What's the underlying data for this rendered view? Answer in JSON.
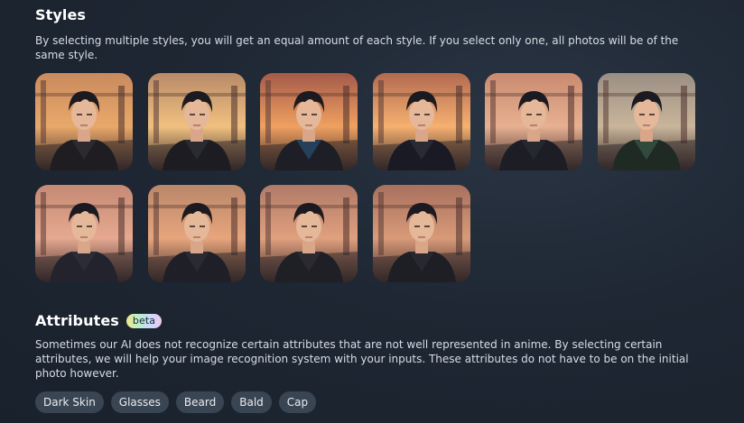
{
  "styles": {
    "title": "Styles",
    "description": "By selecting multiple styles, you will get an equal amount of each style. If you select only one, all photos will be of the same style.",
    "items": [
      {
        "name": "style-1",
        "sky": "#c98a5e",
        "glow": "#e9a86a",
        "shirt": "#2b2a2e",
        "jacket": "#1f1d22"
      },
      {
        "name": "style-2",
        "sky": "#b88a68",
        "glow": "#f0c080",
        "shirt": "#2a2b30",
        "jacket": "#1c1c22"
      },
      {
        "name": "style-3",
        "sky": "#a45a4a",
        "glow": "#f0a060",
        "shirt": "#24405a",
        "jacket": "#1d1e26"
      },
      {
        "name": "style-4",
        "sky": "#b26a50",
        "glow": "#f6b070",
        "shirt": "#2a2a35",
        "jacket": "#1a1a24"
      },
      {
        "name": "style-5",
        "sky": "#c98a70",
        "glow": "#e7b090",
        "shirt": "#262830",
        "jacket": "#1d1d25"
      },
      {
        "name": "style-6",
        "sky": "#9a8e84",
        "glow": "#c9b59a",
        "shirt": "#324a3c",
        "jacket": "#1f2a25"
      },
      {
        "name": "style-7",
        "sky": "#c58a74",
        "glow": "#e6a890",
        "shirt": "#2b2c36",
        "jacket": "#22232d"
      },
      {
        "name": "style-8",
        "sky": "#b9876a",
        "glow": "#e7a57c",
        "shirt": "#2a2a33",
        "jacket": "#1f1f28"
      },
      {
        "name": "style-9",
        "sky": "#b07a68",
        "glow": "#e0a07e",
        "shirt": "#2a2a30",
        "jacket": "#1f1f26"
      },
      {
        "name": "style-10",
        "sky": "#a8705e",
        "glow": "#d89a78",
        "shirt": "#28282f",
        "jacket": "#1e1e25"
      }
    ]
  },
  "attributes": {
    "title": "Attributes",
    "badge": "beta",
    "description": "Sometimes our AI does not recognize certain attributes that are not well represented in anime. By selecting certain attributes, we will help your image recognition system with your inputs. These attributes do not have to be on the initial photo however.",
    "chips": [
      "Dark Skin",
      "Glasses",
      "Beard",
      "Bald",
      "Cap"
    ]
  }
}
